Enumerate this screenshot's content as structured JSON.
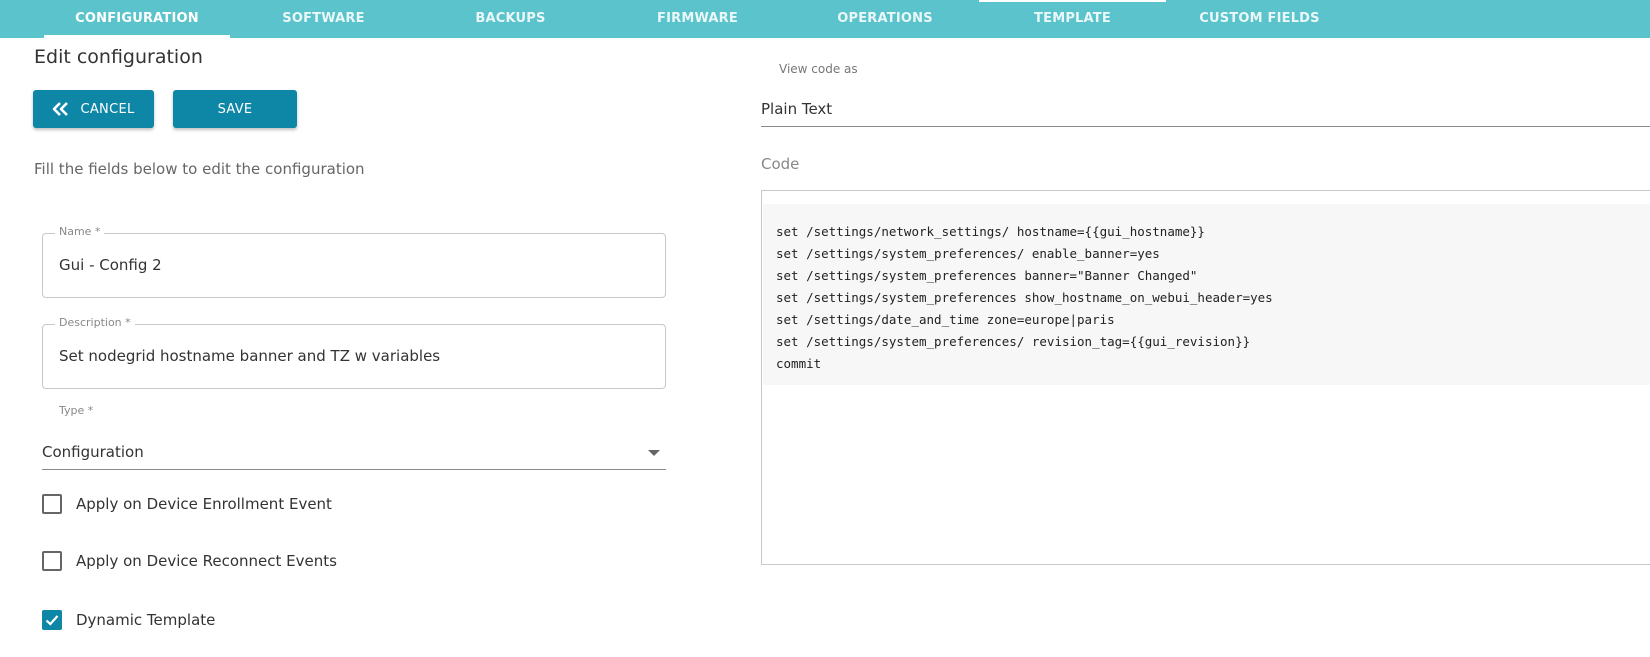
{
  "tabs": [
    {
      "label": "CONFIGURATION"
    },
    {
      "label": "SOFTWARE"
    },
    {
      "label": "BACKUPS"
    },
    {
      "label": "FIRMWARE"
    },
    {
      "label": "OPERATIONS"
    },
    {
      "label": "TEMPLATE"
    },
    {
      "label": "CUSTOM FIELDS"
    }
  ],
  "colors": {
    "nav_bg": "#5bc3cb",
    "button_bg": "#0e86a6",
    "checkbox_checked": "#0e86a6"
  },
  "page": {
    "title": "Edit configuration",
    "cancel_label": "CANCEL",
    "save_label": "SAVE",
    "helper": "Fill the fields below to edit the configuration"
  },
  "form": {
    "name_label": "Name *",
    "name_value": "Gui - Config 2",
    "description_label": "Description *",
    "description_value": "Set nodegrid hostname banner and TZ w variables",
    "type_label": "Type *",
    "type_value": "Configuration",
    "checkboxes": [
      {
        "label": "Apply on Device Enrollment Event",
        "checked": false
      },
      {
        "label": "Apply on Device Reconnect Events",
        "checked": false
      },
      {
        "label": "Dynamic Template",
        "checked": true
      }
    ]
  },
  "code_panel": {
    "view_as_label": "View code as",
    "view_as_value": "Plain Text",
    "code_label": "Code",
    "lines": [
      "set /settings/network_settings/ hostname={{gui_hostname}}",
      "set /settings/system_preferences/ enable_banner=yes",
      "set /settings/system_preferences banner=\"Banner Changed\"",
      "set /settings/system_preferences show_hostname_on_webui_header=yes",
      "set /settings/date_and_time zone=europe|paris",
      "set /settings/system_preferences/ revision_tag={{gui_revision}}",
      "commit"
    ]
  }
}
